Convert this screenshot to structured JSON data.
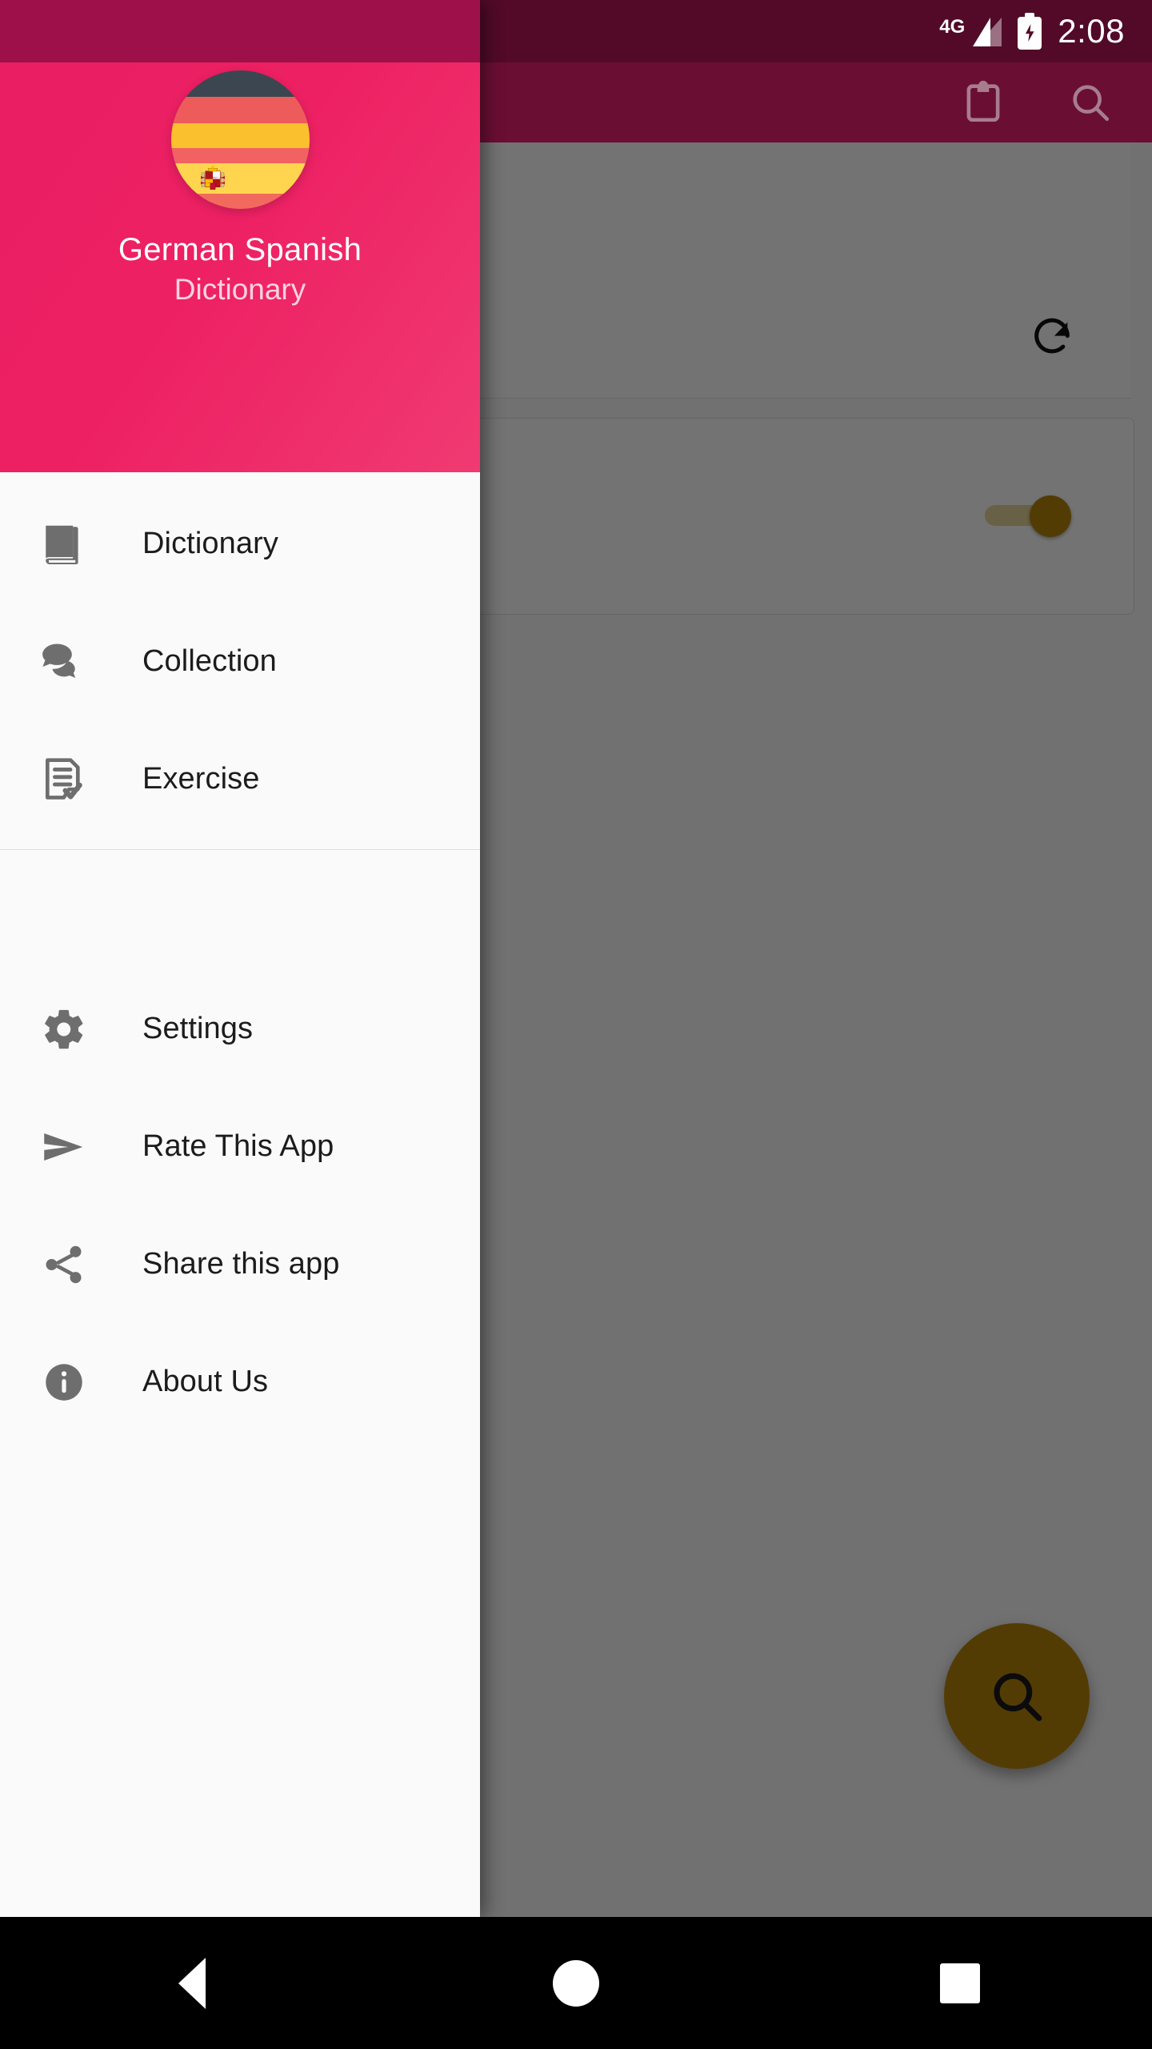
{
  "status_bar": {
    "network_label": "4G",
    "network_icon": "signal-bars-icon",
    "battery_icon": "battery-charging-icon",
    "time": "2:08"
  },
  "background_app": {
    "toolbar": {
      "clipboard_icon": "clipboard-icon",
      "search_icon": "search-icon"
    },
    "refresh_icon": "refresh-icon",
    "toggle": {
      "name": "toggle-switch",
      "state": "on"
    },
    "fab": {
      "icon": "search-icon",
      "color": "#B8860B"
    }
  },
  "drawer": {
    "header": {
      "avatar_icon": "german-spanish-flag-avatar",
      "title": "German Spanish",
      "subtitle": "Dictionary",
      "background_color": "#E91E63"
    },
    "primary_items": [
      {
        "label": "Dictionary",
        "icon": "book-icon"
      },
      {
        "label": "Collection",
        "icon": "chat-bubbles-icon"
      },
      {
        "label": "Exercise",
        "icon": "document-check-icon"
      }
    ],
    "secondary_items": [
      {
        "label": "Settings",
        "icon": "gear-icon"
      },
      {
        "label": "Rate This App",
        "icon": "send-arrow-icon"
      },
      {
        "label": "Share this app",
        "icon": "share-nodes-icon"
      },
      {
        "label": "About Us",
        "icon": "info-circle-icon"
      }
    ]
  },
  "nav_bar": {
    "back": "back-triangle-icon",
    "home": "home-circle-icon",
    "recents": "recents-square-icon"
  }
}
